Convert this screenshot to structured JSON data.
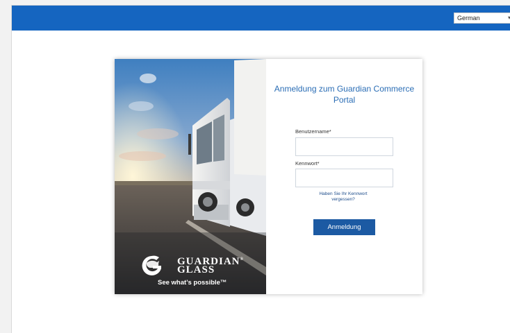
{
  "topbar": {
    "language_select": {
      "value": "German",
      "arrow_icon": "chevron-down-icon"
    },
    "color": "#1565c0"
  },
  "hero": {
    "brand": {
      "logo_icon": "guardian-g-horse-logo-icon",
      "name_line1": "GUARDIAN",
      "name_line2": "GLASS",
      "trademark": "®",
      "tagline": "See what’s possible™"
    }
  },
  "login": {
    "title": "Anmeldung zum Guardian Commerce Portal",
    "username_label": "Benutzername*",
    "username_value": "",
    "password_label": "Kennwort*",
    "password_value": "",
    "forgot_password": "Haben Sie Ihr Kennwort vergessen?",
    "submit_label": "Anmeldung",
    "accent_color": "#2a6db5",
    "button_color": "#1c5aa3"
  }
}
